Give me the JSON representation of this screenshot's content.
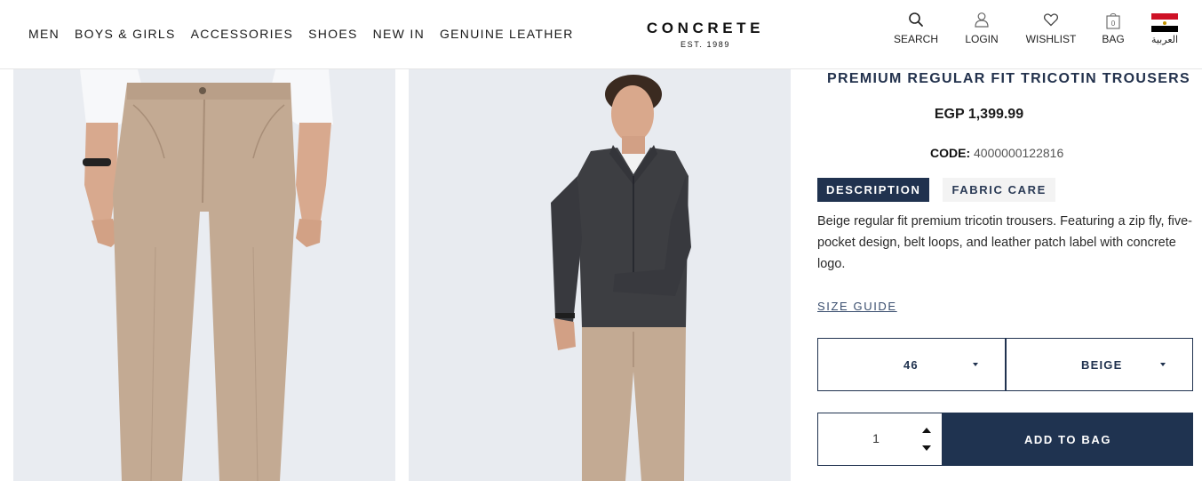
{
  "nav": {
    "items": [
      "MEN",
      "BOYS & GIRLS",
      "ACCESSORIES",
      "SHOES",
      "NEW IN",
      "GENUINE LEATHER"
    ]
  },
  "logo": {
    "brand": "CONCRETE",
    "tagline": "EST. 1989"
  },
  "tools": {
    "search": "SEARCH",
    "login": "LOGIN",
    "wishlist": "WISHLIST",
    "bag": "BAG",
    "bag_count": "0",
    "language": "العربية"
  },
  "product": {
    "title": "PREMIUM REGULAR FIT TRICOTIN TROUSERS",
    "price": "EGP 1,399.99",
    "code_label": "CODE:",
    "code_value": "4000000122816",
    "tabs": [
      "DESCRIPTION",
      "FABRIC CARE"
    ],
    "active_tab": "DESCRIPTION",
    "description": "Beige regular fit premium tricotin trousers. Featuring a zip fly, five-pocket design, belt loops, and leather patch label with concrete logo.",
    "size_guide": "SIZE GUIDE",
    "size_selected": "46",
    "color_selected": "BEIGE",
    "quantity": "1",
    "add_to_bag": "ADD TO BAG"
  },
  "colors": {
    "navy": "#20324f",
    "beige_trousers": "#c3aa93",
    "image_bg": "#e9ecf1"
  }
}
